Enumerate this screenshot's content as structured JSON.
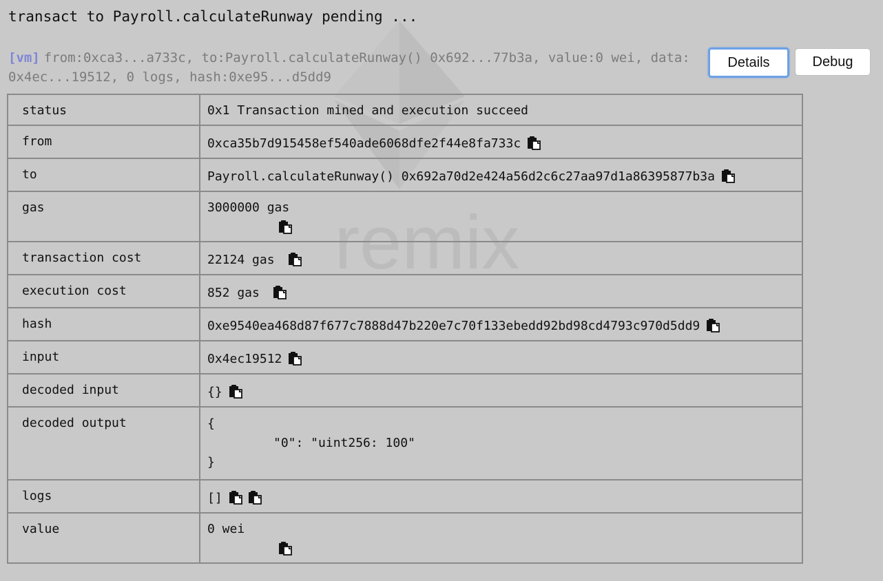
{
  "pending_text": "transact to Payroll.calculateRunway pending ...",
  "summary": {
    "tag": "[vm]",
    "text": "from:0xca3...a733c, to:Payroll.calculateRunway() 0x692...77b3a, value:0 wei, data:0x4ec...19512, 0 logs, hash:0xe95...d5dd9"
  },
  "buttons": {
    "details": "Details",
    "debug": "Debug"
  },
  "rows": {
    "status": {
      "key": "status",
      "value": "0x1 Transaction mined and execution succeed"
    },
    "from": {
      "key": "from",
      "value": "0xca35b7d915458ef540ade6068dfe2f44e8fa733c"
    },
    "to": {
      "key": "to",
      "value": "Payroll.calculateRunway() 0x692a70d2e424a56d2c6c27aa97d1a86395877b3a"
    },
    "gas": {
      "key": "gas",
      "value": "3000000 gas"
    },
    "transaction_cost": {
      "key": "transaction cost",
      "value": "22124 gas"
    },
    "execution_cost": {
      "key": "execution cost",
      "value": "852 gas"
    },
    "hash": {
      "key": "hash",
      "value": "0xe9540ea468d87f677c7888d47b220e7c70f133ebedd92bd98cd4793c970d5dd9"
    },
    "input": {
      "key": "input",
      "value": "0x4ec19512"
    },
    "decoded_input": {
      "key": "decoded input",
      "value": "{}"
    },
    "decoded_output": {
      "key": "decoded output",
      "open": "{",
      "line": "\"0\": \"uint256: 100\"",
      "close": "}"
    },
    "logs": {
      "key": "logs",
      "value": "[]"
    },
    "value": {
      "key": "value",
      "value": "0 wei"
    }
  },
  "watermark_text": "remix",
  "icons": {
    "copy": "copy-icon",
    "logo": "ethereum-logo"
  }
}
